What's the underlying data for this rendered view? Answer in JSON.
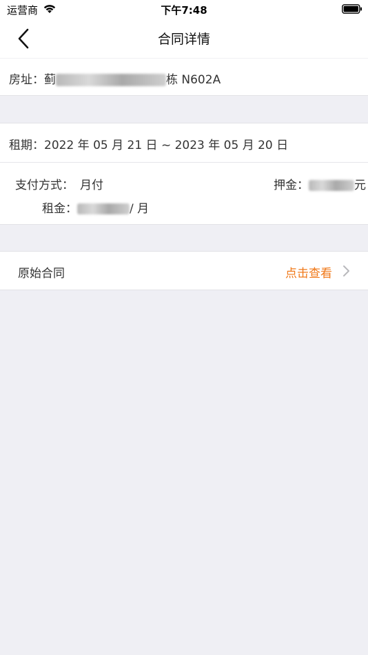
{
  "status_bar": {
    "carrier": "运营商",
    "time": "下午7:48"
  },
  "nav": {
    "title": "合同详情"
  },
  "address": {
    "label": "房址：",
    "value_prefix": "蓟",
    "value_suffix": "栋 N602A"
  },
  "lease": {
    "text": "租期：2022 年 05 月 21 日 ~ 2023 年 05 月 20 日"
  },
  "payment": {
    "method_label": "支付方式：",
    "method_value": "月付",
    "deposit_label": "押金：",
    "deposit_unit": "元",
    "rent_label": "租金：",
    "rent_unit": "/ 月"
  },
  "contract": {
    "label": "原始合同",
    "link": "点击查看"
  },
  "colors": {
    "accent": "#f07818",
    "background": "#efeff4"
  },
  "icons": {
    "back": "chevron-left-icon",
    "wifi": "wifi-icon",
    "battery": "battery-icon",
    "disclosure": "chevron-right-icon"
  }
}
